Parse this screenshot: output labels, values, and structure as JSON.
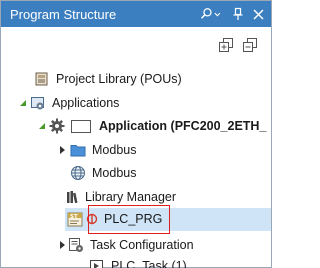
{
  "panel": {
    "title": "Program Structure",
    "title_buttons": [
      "search-options",
      "dropdown",
      "pin",
      "close"
    ]
  },
  "toolbar": {
    "icons": [
      "expand-all-icon",
      "collapse-all-icon"
    ]
  },
  "tree": {
    "project_library": "Project Library (POUs)",
    "applications": "Applications",
    "application_name": "Application (PFC200_2ETH_",
    "modbus_folder": "Modbus",
    "modbus_device": "Modbus",
    "library_manager": "Library Manager",
    "plc_prg": "PLC_PRG",
    "task_configuration": "Task Configuration",
    "plc_task": "PLC_Task (1)"
  },
  "colors": {
    "titlebar": "#3c7fc0",
    "selection": "#cfe4f7",
    "highlight_border": "#e02020",
    "folder": "#4a90d9"
  }
}
